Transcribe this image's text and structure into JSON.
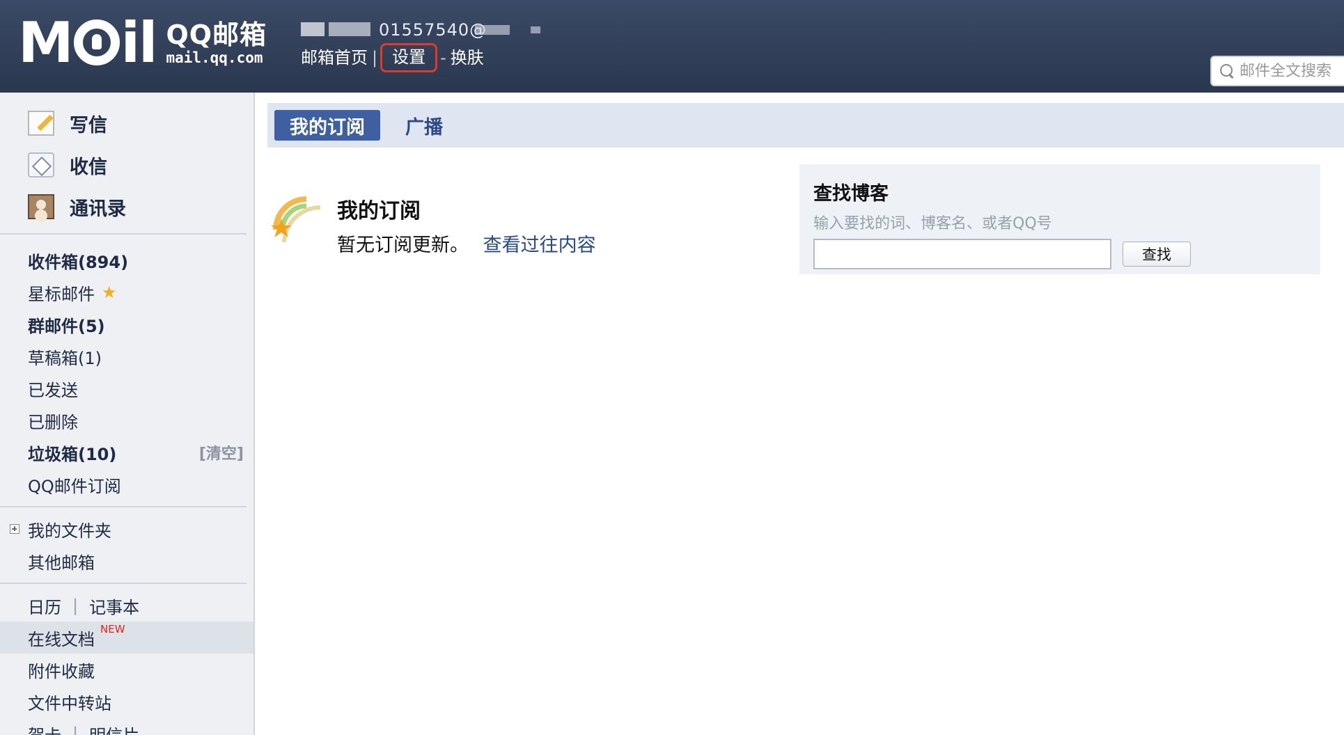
{
  "header": {
    "logo_word": "M",
    "logo_word_tail": "il",
    "logo_cn": "QQ邮箱",
    "logo_domain": "mail.qq.com",
    "account_visible": "01557540@",
    "links": {
      "home": "邮箱首页",
      "separator": "|",
      "settings": "设置",
      "dash": "-",
      "skin": "换肤"
    },
    "search_placeholder": "邮件全文搜索"
  },
  "sidebar": {
    "quick": [
      {
        "label": "写信",
        "icon": "compose-icon"
      },
      {
        "label": "收信",
        "icon": "inbox-icon"
      },
      {
        "label": "通讯录",
        "icon": "contacts-icon"
      }
    ],
    "folders": {
      "inbox": "收件箱(894)",
      "starred": "星标邮件",
      "group": "群邮件(5)",
      "drafts": "草稿箱(1)",
      "sent": "已发送",
      "deleted": "已删除",
      "spam": "垃圾箱(10)",
      "spam_clear": "[清空]",
      "subscriptions": "QQ邮件订阅"
    },
    "my_folders": "我的文件夹",
    "other_mailboxes": "其他邮箱",
    "calendar": "日历",
    "pipe": "|",
    "notepad": "记事本",
    "online_docs": "在线文档",
    "new_badge": "NEW",
    "attachments": "附件收藏",
    "file_transfer": "文件中转站",
    "greeting_card": "贺卡",
    "postcard": "明信片"
  },
  "main": {
    "tabs": [
      "我的订阅",
      "广播"
    ],
    "subscription_title": "我的订阅",
    "subscription_empty": "暂无订阅更新。",
    "view_past": "查看过往内容",
    "finder": {
      "title": "查找博客",
      "hint": "输入要找的词、博客名、或者QQ号",
      "input_value": "",
      "button": "查找"
    }
  },
  "colors": {
    "topbar": "#2f3c55",
    "tab_active": "#3f5fa3",
    "link": "#25498d",
    "highlight_box": "#e23a2a",
    "new_badge": "#e0251b"
  }
}
